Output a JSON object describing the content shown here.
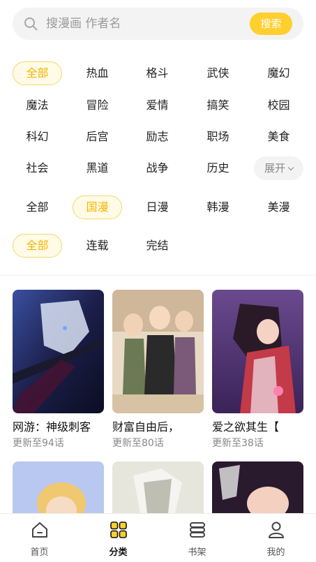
{
  "search": {
    "placeholder": "搜漫画 作者名",
    "button_label": "搜索"
  },
  "filters": {
    "genres": [
      [
        "全部",
        "热血",
        "格斗",
        "武侠",
        "魔幻"
      ],
      [
        "魔法",
        "冒险",
        "爱情",
        "搞笑",
        "校园"
      ],
      [
        "科幻",
        "后宫",
        "励志",
        "职场",
        "美食"
      ],
      [
        "社会",
        "黑道",
        "战争",
        "历史"
      ]
    ],
    "expand_label": "展开",
    "regions": [
      "全部",
      "国漫",
      "日漫",
      "韩漫",
      "美漫"
    ],
    "status": [
      "全部",
      "连载",
      "完结"
    ],
    "selected": {
      "genre": "全部",
      "region": "国漫",
      "status": "全部"
    }
  },
  "comics": [
    {
      "title": "网游：神级刺客",
      "update": "更新至94话"
    },
    {
      "title": "财富自由后，",
      "update": "更新至80话"
    },
    {
      "title": "爱之欲其生【",
      "update": "更新至38话"
    },
    {
      "title": "",
      "update": ""
    },
    {
      "title": "",
      "update": ""
    },
    {
      "title": "",
      "update": ""
    }
  ],
  "bottom_nav": {
    "items": [
      {
        "label": "首页",
        "icon": "home-icon"
      },
      {
        "label": "分类",
        "icon": "category-grid-icon"
      },
      {
        "label": "书架",
        "icon": "bookshelf-icon"
      },
      {
        "label": "我的",
        "icon": "user-icon"
      }
    ],
    "active": "分类"
  },
  "colors": {
    "accent": "#ffcf2e",
    "selected_text": "#f4b400",
    "selected_bg": "#fffbe6",
    "chip_border": "#f5d66e"
  }
}
